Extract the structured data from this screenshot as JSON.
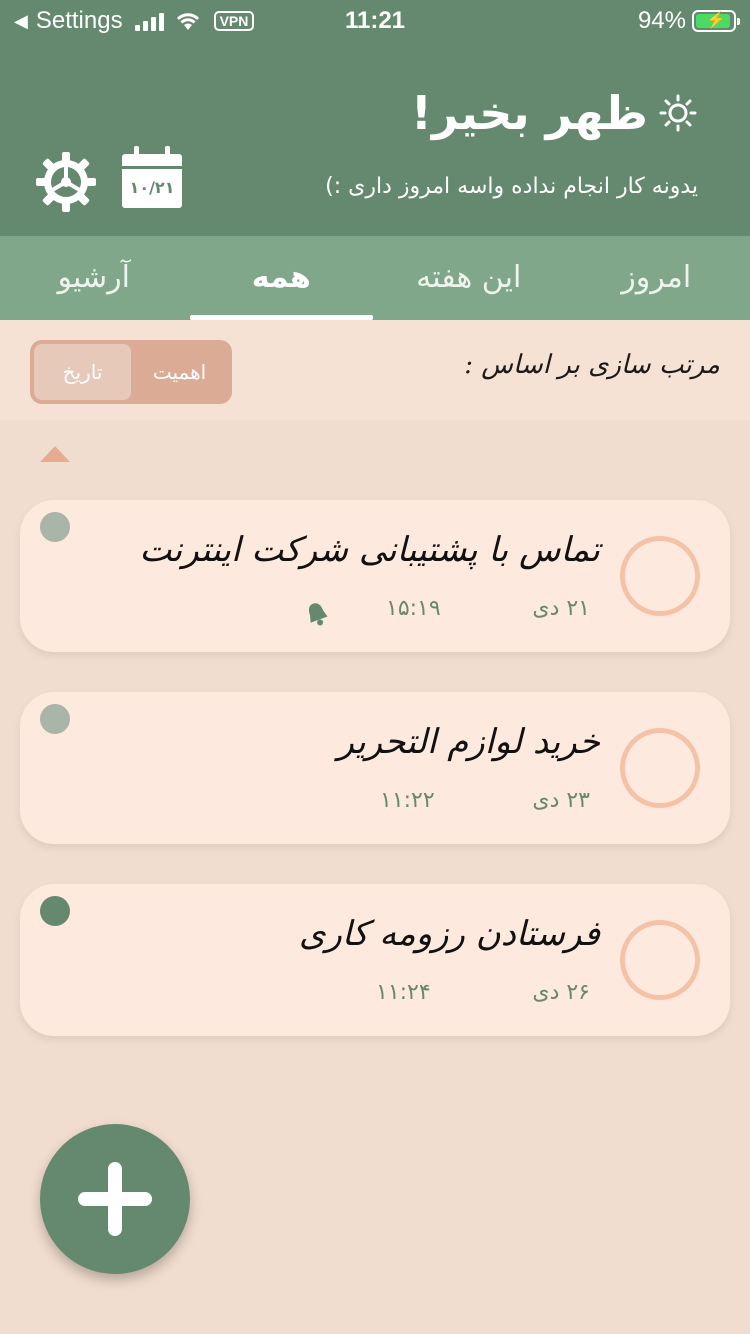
{
  "status_bar": {
    "back_label": "Settings",
    "time": "11:21",
    "vpn": "VPN",
    "battery": "94%"
  },
  "header": {
    "greeting": "ظهر بخیر!",
    "subtitle": "یدونه کار انجام نداده واسه امروز داری :)",
    "calendar_date": "۱۰/۲۱"
  },
  "tabs": [
    {
      "label": "آرشیو"
    },
    {
      "label": "همه"
    },
    {
      "label": "این هفته"
    },
    {
      "label": "امروز"
    }
  ],
  "sort": {
    "label": "مرتب سازی بر اساس :",
    "options": [
      "تاریخ",
      "اهمیت"
    ],
    "selected": "تاریخ"
  },
  "tasks": [
    {
      "title": "تماس با پشتیبانی شرکت اینترنت",
      "date": "۲۱ دی",
      "time": "۱۵:۱۹",
      "has_reminder": true,
      "priority_color": "#a9b5a6"
    },
    {
      "title": "خرید لوازم التحریر",
      "date": "۲۳ دی",
      "time": "۱۱:۲۲",
      "has_reminder": false,
      "priority_color": "#a9b5a6"
    },
    {
      "title": "فرستادن رزومه کاری",
      "date": "۲۶ دی",
      "time": "۱۱:۲۴",
      "has_reminder": false,
      "priority_color": "#65896f"
    }
  ],
  "colors": {
    "primary": "#65896f",
    "tab_bar": "#80a78a",
    "card": "#fde9dd",
    "circle": "#f4c2a6"
  }
}
